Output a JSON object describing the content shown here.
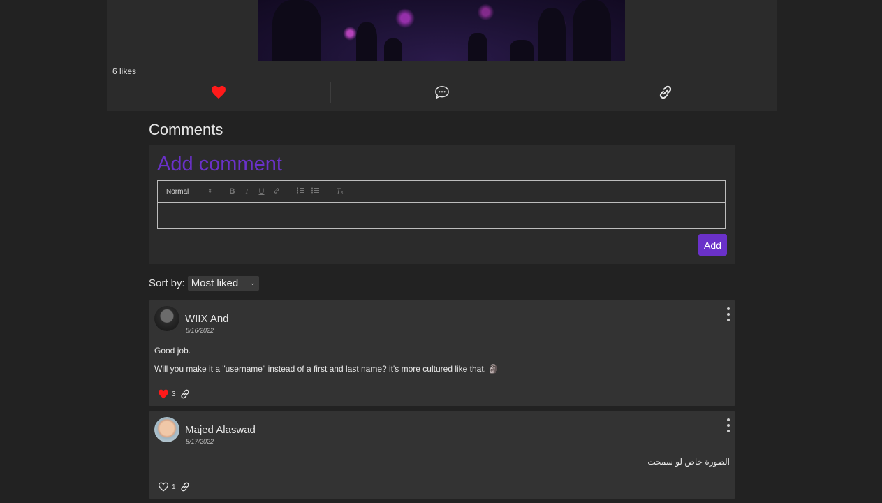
{
  "post": {
    "likes_text": "6 likes"
  },
  "comments_section": {
    "title": "Comments",
    "add_comment": {
      "heading": "Add comment",
      "toolbar": {
        "format_select": "Normal",
        "buttons": [
          "bold-icon",
          "italic-icon",
          "underline-icon",
          "link-icon",
          "ordered-list-icon",
          "bullet-list-icon",
          "clear-format-icon"
        ]
      },
      "submit_label": "Add",
      "accent": "#6a31c9"
    },
    "sort": {
      "label": "Sort by:",
      "selected": "Most liked"
    },
    "comments": [
      {
        "author": "WIIX And",
        "date": "8/16/2022",
        "lines": [
          "Good job.",
          "Will you make it a \"username\" instead of a first and last name? it's more cultured like that. 🗿"
        ],
        "likes": "3",
        "liked": true
      },
      {
        "author": "Majed Alaswad",
        "date": "8/17/2022",
        "lines": [
          "الصورة خاص لو سمحت"
        ],
        "likes": "1",
        "liked": false
      }
    ]
  },
  "colors": {
    "background": "#222222",
    "card": "#2b2b2b",
    "comment_card": "#333333",
    "like_red": "#ff1a1a"
  }
}
